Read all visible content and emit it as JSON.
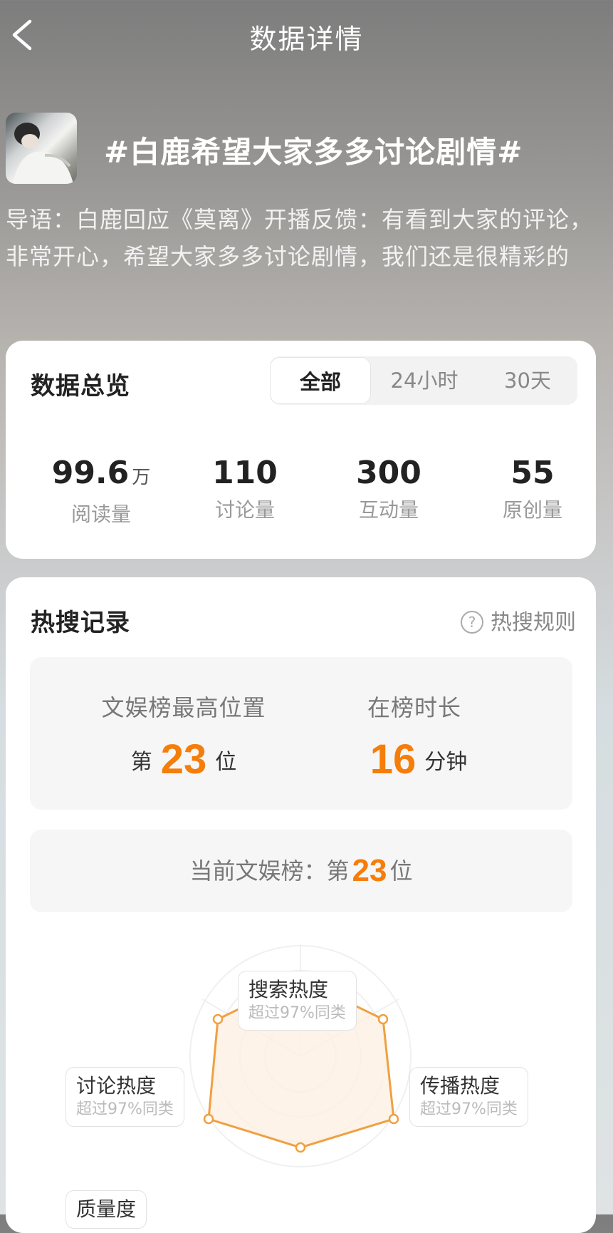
{
  "header": {
    "title": "数据详情"
  },
  "topic": {
    "title": "#白鹿希望大家多多讨论剧情#",
    "intro": "导语：白鹿回应《莫离》开播反馈：有看到大家的评论，非常开心，希望大家多多讨论剧情，我们还是很精彩的"
  },
  "overview": {
    "title": "数据总览",
    "tabs": [
      "全部",
      "24小时",
      "30天"
    ],
    "active_tab": "全部",
    "stats": [
      {
        "value": "99.6",
        "unit": "万",
        "label": "阅读量"
      },
      {
        "value": "110",
        "unit": "",
        "label": "讨论量"
      },
      {
        "value": "300",
        "unit": "",
        "label": "互动量"
      },
      {
        "value": "55",
        "unit": "",
        "label": "原创量"
      }
    ]
  },
  "hot_search": {
    "title": "热搜记录",
    "rules_label": "热搜规则",
    "rules_icon": "help-circle-icon",
    "highest": {
      "label": "文娱榜最高位置",
      "prefix": "第",
      "value": "23",
      "suffix": "位"
    },
    "duration": {
      "label": "在榜时长",
      "value": "16",
      "suffix": "分钟"
    },
    "current": {
      "label": "当前文娱榜：第",
      "value": "23",
      "suffix": "位"
    },
    "radar": {
      "axes": [
        {
          "title": "搜索热度",
          "sub": "超过97%同类"
        },
        {
          "title": "传播热度",
          "sub": "超过97%同类"
        },
        {
          "title": "讨论热度",
          "sub": "超过97%同类"
        },
        {
          "title": "质量度",
          "sub": ""
        }
      ],
      "accent_color": "#f0a040"
    }
  },
  "colors": {
    "accent": "#f57e0b",
    "card_bg": "#ffffff"
  }
}
